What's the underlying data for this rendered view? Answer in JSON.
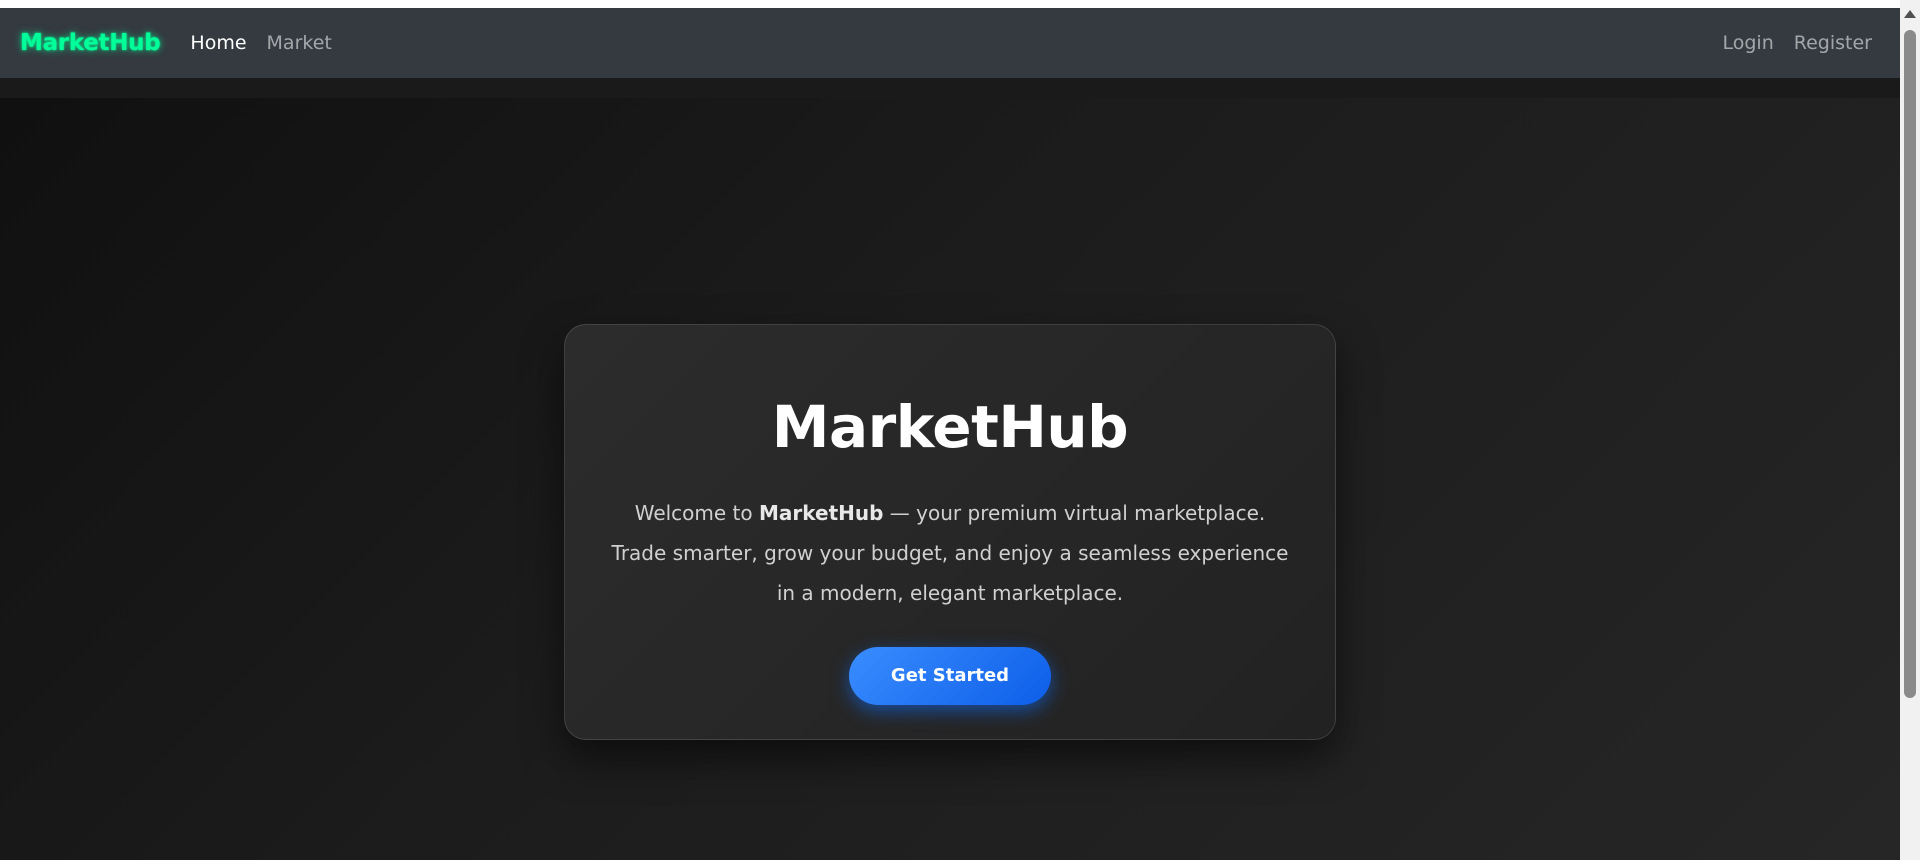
{
  "navbar": {
    "brand": "MarketHub",
    "links": [
      {
        "label": "Home",
        "active": true
      },
      {
        "label": "Market",
        "active": false
      }
    ],
    "auth": [
      {
        "label": "Login"
      },
      {
        "label": "Register"
      }
    ]
  },
  "hero": {
    "title": "MarketHub",
    "line1_prefix": "Welcome to ",
    "line1_brand": "MarketHub",
    "line1_suffix": " — your premium virtual marketplace.",
    "line2": "Trade smarter, grow your budget, and enjoy a seamless experience",
    "line3": "in a modern, elegant marketplace.",
    "cta_label": "Get Started"
  },
  "colors": {
    "brand_glow": "#00ff99",
    "navbar_bg": "#343a40",
    "button_accent": "#0d6efd"
  }
}
